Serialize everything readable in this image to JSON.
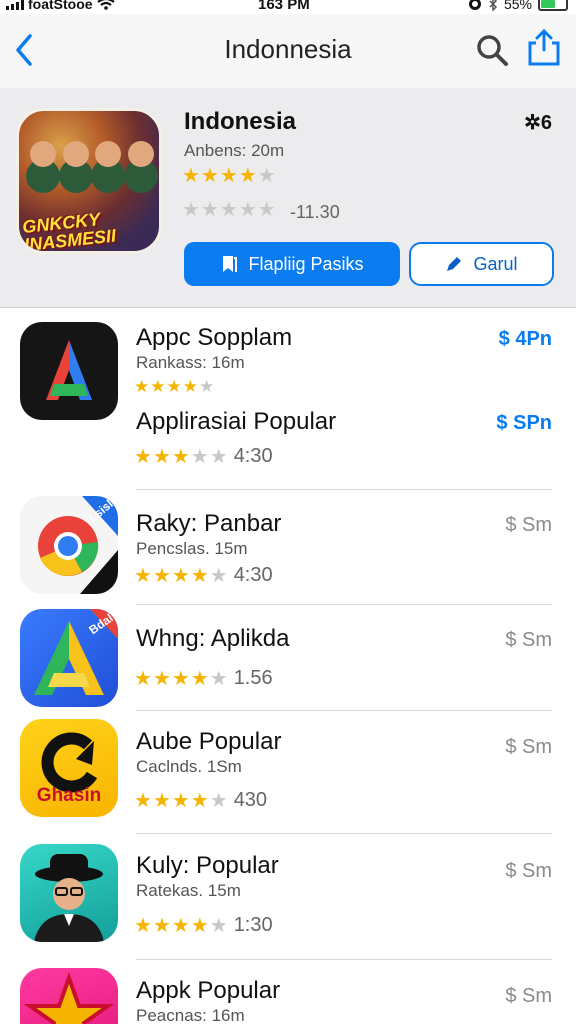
{
  "status_bar": {
    "carrier": "foatStooe",
    "time": "163 PM",
    "battery": "55%"
  },
  "nav": {
    "title": "Indonnesia"
  },
  "featured": {
    "name": "Indonesia",
    "badge": "✲6",
    "subtitle": "Anbens: 20m",
    "rating_primary": 4,
    "rating_secondary": 0,
    "score": "-11.30",
    "art_text": "GNKCKY INASMESII",
    "primary_button": "Flapliig Pasiks",
    "secondary_button": "Garul"
  },
  "apps": [
    {
      "name": "Appc Sopplam",
      "subtitle": "Rankass: 16m",
      "rating": 4,
      "score": "",
      "price": "$ 4Pn",
      "price_style": "blue",
      "icon": "a-logo-icon"
    },
    {
      "name": "Applirasiai Popular",
      "subtitle": "",
      "rating": 3,
      "score": "4:30",
      "price": "$ SPn",
      "price_style": "blue",
      "icon": ""
    },
    {
      "name": "Raky: Panbar",
      "subtitle": "Pencslas. 15m",
      "rating": 4,
      "score": "4:30",
      "price": "$ Sm",
      "price_style": "gray",
      "icon": "chrome-logo-icon",
      "icon_badge": "Lsisl"
    },
    {
      "name": "Whng: Aplikda",
      "subtitle": "",
      "rating": 4,
      "score": "1.56",
      "price": "$ Sm",
      "price_style": "gray",
      "icon": "triangle-a-icon",
      "icon_badge": "Bdal"
    },
    {
      "name": "Aube Popular",
      "subtitle": "Caclnds. 1Sm",
      "rating": 4,
      "score": "430",
      "price": "$ Sm",
      "price_style": "gray",
      "icon": "ghasin-logo-icon",
      "icon_text": "Ghasin"
    },
    {
      "name": "Kuly: Popular",
      "subtitle": "Ratekas. 15m",
      "rating": 4,
      "score": "1:30",
      "price": "$ Sm",
      "price_style": "gray",
      "icon": "man-portrait-icon"
    },
    {
      "name": "Appk Popular",
      "subtitle": "Peacnas: 16m",
      "rating": 0,
      "score": "",
      "price": "$ Sm",
      "price_style": "gray",
      "icon": "star-logo-icon"
    }
  ]
}
